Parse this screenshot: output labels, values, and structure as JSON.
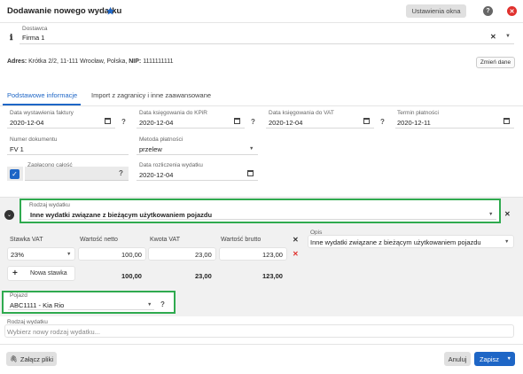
{
  "header": {
    "title": "Dodawanie nowego wydatku",
    "settings_label": "Ustawienia okna"
  },
  "supplier": {
    "label": "Dostawca",
    "value": "Firma 1",
    "address_label": "Adres:",
    "address_value": "Krótka 2/2, 11-111 Wrocław, Polska,",
    "nip_label": "NIP:",
    "nip_value": "1111111111",
    "change_label": "Zmień dane"
  },
  "tabs": [
    {
      "label": "Podstawowe informacje",
      "active": true
    },
    {
      "label": "Import z zagranicy i inne zaawansowane",
      "active": false
    }
  ],
  "fields": {
    "invoice_date": {
      "label": "Data wystawienia faktury",
      "value": "2020-12-04"
    },
    "kpir_date": {
      "label": "Data księgowania do KPiR",
      "value": "2020-12-04"
    },
    "vat_date": {
      "label": "Data księgowania do VAT",
      "value": "2020-12-04"
    },
    "due_date": {
      "label": "Termin płatności",
      "value": "2020-12-11"
    },
    "doc_number": {
      "label": "Numer dokumentu",
      "value": "FV 1"
    },
    "payment_method": {
      "label": "Metoda płatności",
      "value": "przelew"
    },
    "paid_full": {
      "label": "Zapłacono całość",
      "checked": true
    },
    "settlement_date": {
      "label": "Data rozliczenia wydatku",
      "value": "2020-12-04"
    }
  },
  "expense": {
    "type_label": "Rodzaj wydatku",
    "type_value": "Inne wydatki związane z bieżącym użytkowaniem pojazdu",
    "table_headers": [
      "Stawka VAT",
      "Wartość netto",
      "Kwota VAT",
      "Wartość brutto"
    ],
    "row": {
      "rate": "23%",
      "net": "100,00",
      "vat": "23,00",
      "gross": "123,00"
    },
    "add_rate_label": "Nowa stawka",
    "totals": {
      "net": "100,00",
      "vat": "23,00",
      "gross": "123,00"
    },
    "desc_label": "Opis",
    "desc_value": "Inne wydatki związane z bieżącym użytkowaniem pojazdu",
    "vehicle_label": "Pojazd",
    "vehicle_value": "ABC1111 - Kia Rio"
  },
  "new_expense": {
    "label": "Rodzaj wydatku",
    "placeholder": "Wybierz nowy rodzaj wydatku..."
  },
  "footer": {
    "attach_label": "Załącz pliki",
    "cancel_label": "Anuluj",
    "save_label": "Zapisz"
  },
  "colors": {
    "accent": "#1e66c6",
    "highlight": "#2faa4f",
    "danger": "#e0312e"
  }
}
